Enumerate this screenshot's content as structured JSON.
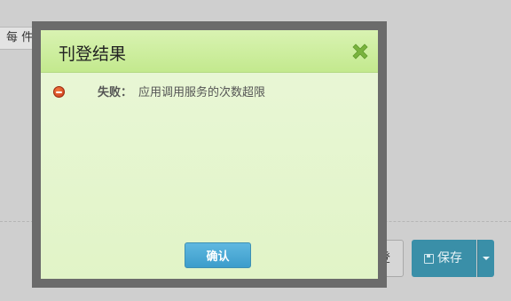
{
  "background": {
    "per_unit_label": "每 件",
    "login_button_fragment": "登",
    "save_button_label": "保存",
    "save_icon": "floppy-disk-icon",
    "caret_icon": "caret-down-icon"
  },
  "modal": {
    "title": "刊登结果",
    "close_icon": "close-x-icon",
    "result": {
      "status_icon": "error-minus-icon",
      "status_label": "失败：",
      "message": "应用调用服务的次数超限"
    },
    "confirm_label": "确认"
  },
  "colors": {
    "overlay": "#cfcfcf",
    "modal_frame": "#6b6b6b",
    "modal_header": "#c3e98e",
    "modal_body": "#e1f4c7",
    "close_x": "#7ab33e",
    "confirm_button": "#3c9dcb",
    "save_button": "#3a8fa8",
    "error_icon": "#d9431f"
  }
}
